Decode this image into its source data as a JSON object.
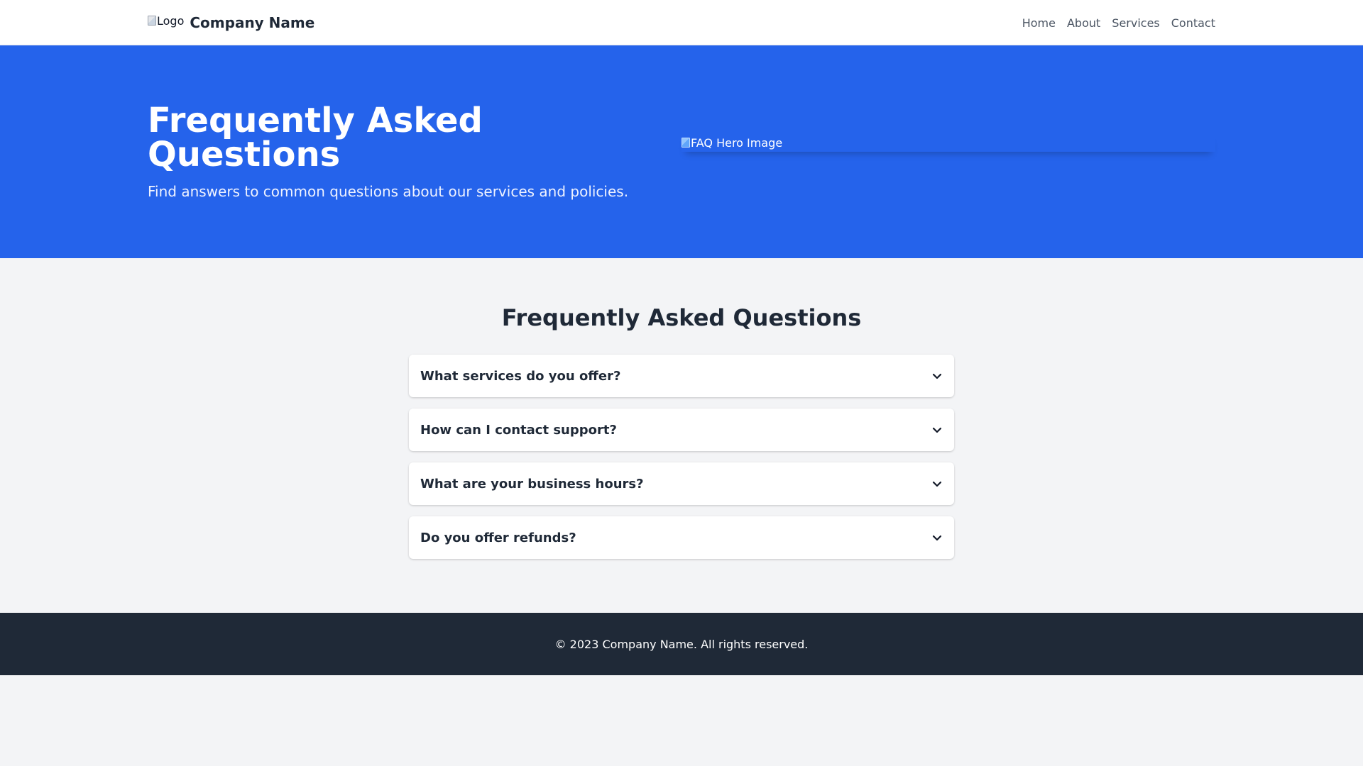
{
  "header": {
    "logo_alt": "Logo",
    "company_name": "Company Name",
    "nav": [
      "Home",
      "About",
      "Services",
      "Contact"
    ]
  },
  "hero": {
    "title": "Frequently Asked Questions",
    "subtitle": "Find answers to common questions about our services and policies.",
    "image_alt": "FAQ Hero Image"
  },
  "faq": {
    "heading": "Frequently Asked Questions",
    "items": [
      {
        "question": "What services do you offer?",
        "icon": "chevron-down-icon"
      },
      {
        "question": "How can I contact support?",
        "icon": "chevron-down-icon"
      },
      {
        "question": "What are your business hours?",
        "icon": "chevron-down-icon"
      },
      {
        "question": "Do you offer refunds?",
        "icon": "chevron-down-icon"
      }
    ]
  },
  "footer": {
    "copyright": "© 2023 Company Name. All rights reserved."
  },
  "colors": {
    "primary": "#2563eb",
    "footer_bg": "#1f2937",
    "page_bg": "#f3f4f6"
  }
}
